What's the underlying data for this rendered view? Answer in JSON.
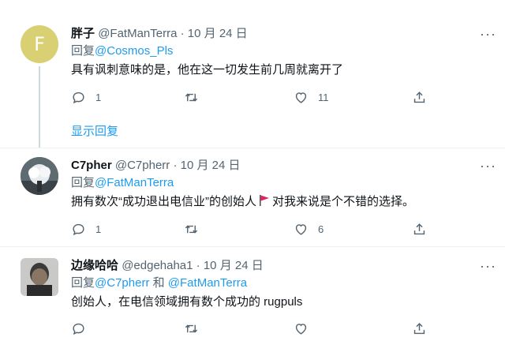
{
  "tweets": [
    {
      "avatar_letter": "F",
      "name": "胖子",
      "handle": "@FatManTerra",
      "separator": "·",
      "date": "10 月 24 日",
      "reply_prefix": "回复",
      "reply_to": "@Cosmos_Pls",
      "text": "具有讽刺意味的是，他在这一切发生前几周就离开了",
      "replies": "1",
      "retweets": "",
      "likes": "11",
      "show_replies": "显示回复"
    },
    {
      "name": "C7pher",
      "handle": "@C7pherr",
      "separator": "·",
      "date": "10 月 24 日",
      "reply_prefix": "回复",
      "reply_to": "@FatManTerra",
      "text_before": "拥有数次“成功退出电信业”的创始人",
      "text_after": "对我来说是个不错的选择。",
      "replies": "1",
      "retweets": "",
      "likes": "6"
    },
    {
      "name": "边缘哈哈",
      "handle": "@edgehaha1",
      "separator": "·",
      "date": "10 月 24 日",
      "reply_prefix": "回复",
      "reply_to_1": "@C7pherr",
      "and": "和",
      "reply_to_2": "@FatManTerra",
      "text": "创始人，在电信领域拥有数个成功的 rugpuls"
    }
  ],
  "icons": {
    "more": "more-horizontal-icon",
    "reply": "reply-icon",
    "retweet": "retweet-icon",
    "like": "heart-icon",
    "share": "share-icon",
    "flag": "red-flag-icon"
  },
  "colors": {
    "link": "#1d9bf0",
    "muted": "#536471",
    "flag": "#e0245e"
  }
}
